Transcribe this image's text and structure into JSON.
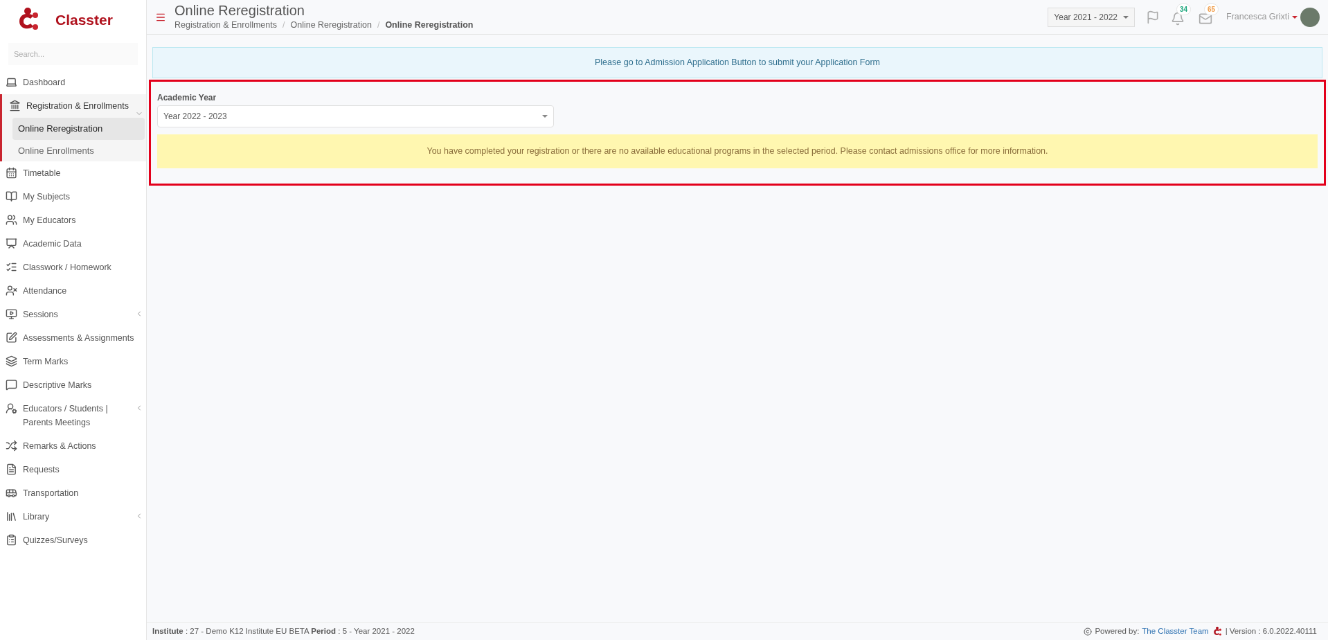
{
  "brand": {
    "name": "Classter"
  },
  "sidebar": {
    "search_placeholder": "Search...",
    "items": [
      {
        "label": "Dashboard",
        "selected": false,
        "has_submenu": false
      },
      {
        "label": "Registration & Enrollments",
        "selected": false,
        "has_submenu": true,
        "expanded": true,
        "children": [
          {
            "label": "Online Reregistration",
            "selected": true
          },
          {
            "label": "Online Enrollments",
            "selected": false
          }
        ]
      },
      {
        "label": "Timetable",
        "selected": false,
        "has_submenu": false
      },
      {
        "label": "My Subjects",
        "selected": false,
        "has_submenu": false
      },
      {
        "label": "My Educators",
        "selected": false,
        "has_submenu": false
      },
      {
        "label": "Academic Data",
        "selected": false,
        "has_submenu": false
      },
      {
        "label": "Classwork / Homework",
        "selected": false,
        "has_submenu": false
      },
      {
        "label": "Attendance",
        "selected": false,
        "has_submenu": false
      },
      {
        "label": "Sessions",
        "selected": false,
        "has_submenu": true,
        "expanded": false
      },
      {
        "label": "Assessments & Assignments",
        "selected": false,
        "has_submenu": false
      },
      {
        "label": "Term Marks",
        "selected": false,
        "has_submenu": false
      },
      {
        "label": "Descriptive Marks",
        "selected": false,
        "has_submenu": false
      },
      {
        "label": "Educators / Students | Parents Meetings",
        "selected": false,
        "has_submenu": true,
        "expanded": false
      },
      {
        "label": "Remarks & Actions",
        "selected": false,
        "has_submenu": false
      },
      {
        "label": "Requests",
        "selected": false,
        "has_submenu": false
      },
      {
        "label": "Transportation",
        "selected": false,
        "has_submenu": false
      },
      {
        "label": "Library",
        "selected": false,
        "has_submenu": true,
        "expanded": false
      },
      {
        "label": "Quizzes/Surveys",
        "selected": false,
        "has_submenu": false
      }
    ]
  },
  "header": {
    "title": "Online Reregistration",
    "breadcrumbs": [
      "Registration & Enrollments",
      "Online Reregistration",
      "Online Reregistration"
    ],
    "breadcrumb_separator": "/",
    "year_select": "Year 2021 - 2022",
    "notifications": "34",
    "messages": "65",
    "user": "Francesca Grixti"
  },
  "info_banner": "Please go to Admission Application Button to submit your Application Form",
  "form": {
    "label": "Academic Year",
    "value": "Year 2022 - 2023",
    "highlighted": true
  },
  "warning": "You have completed your registration or there are no available educational programs in the selected period. Please contact admissions office for more information.",
  "footer": {
    "left": "**Institute** : 27 - Demo K12 Institute EU BETA **Period** : 5 - Year 2021 - 2022",
    "powered": "Powered by:",
    "team": "The Classter Team",
    "version": "| Version : 6.0.2022.40111"
  }
}
